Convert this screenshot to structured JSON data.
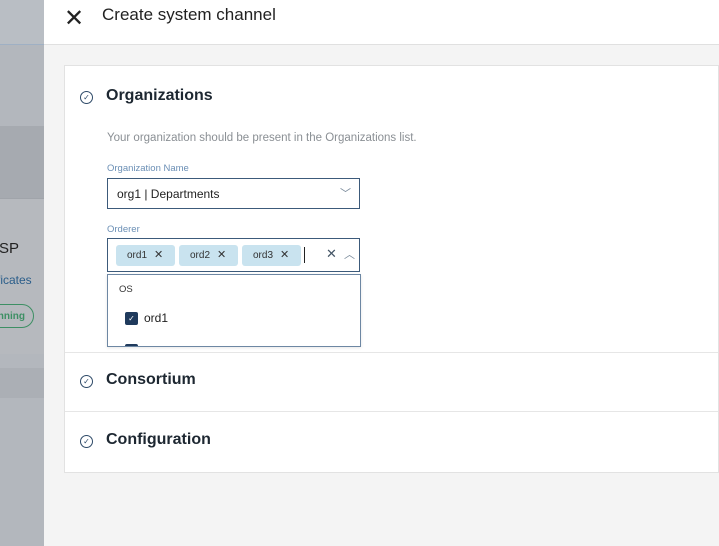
{
  "background": {
    "text1": "SP",
    "text2": "rtificates",
    "status": "nning"
  },
  "header": {
    "title": "Create system channel"
  },
  "sections": [
    {
      "title": "Organizations",
      "hint": "Your organization should be present in the Organizations list.",
      "org_label": "Organization Name",
      "org_value": "org1 | Departments",
      "orderer_label": "Orderer",
      "orderer_tags": [
        "ord1",
        "ord2",
        "ord3"
      ],
      "menu": {
        "group": "OS",
        "options": [
          {
            "label": "ord1",
            "checked": true
          },
          {
            "label": "",
            "checked": true
          }
        ]
      }
    },
    {
      "title": "Consortium"
    },
    {
      "title": "Configuration"
    }
  ],
  "colors": {
    "accent": "#1f3a5c",
    "tag": "#c9e3ef",
    "running": "#3d8f64"
  }
}
